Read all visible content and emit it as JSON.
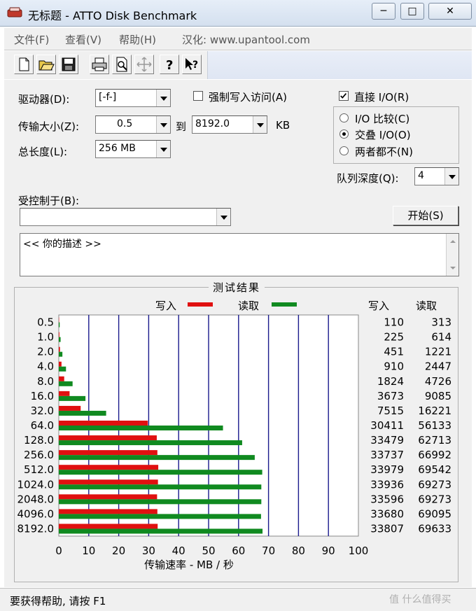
{
  "window": {
    "title": "无标题 - ATTO Disk Benchmark",
    "minimize": "─",
    "maximize": "□",
    "close": "✕"
  },
  "menu": [
    "文件(F)",
    "查看(V)",
    "帮助(H)",
    "汉化: www.upantool.com"
  ],
  "toolbar": [
    "new-icon",
    "open-icon",
    "save-icon",
    "print-icon",
    "print-preview-icon",
    "move-icon",
    "help-icon",
    "context-help-icon"
  ],
  "form": {
    "drive_label": "驱动器(D):",
    "drive_value": "[-f-]",
    "force_write_label": "强制写入访问(A)",
    "force_write_checked": false,
    "direct_io_label": "直接 I/O(R)",
    "direct_io_checked": true,
    "transfer_label": "传输大小(Z):",
    "transfer_from": "0.5",
    "to_label": "到",
    "transfer_to": "8192.0",
    "kb_label": "KB",
    "total_label": "总长度(L):",
    "total_value": "256 MB",
    "radio_options": [
      "I/O 比较(C)",
      "交叠 I/O(O)",
      "两者都不(N)"
    ],
    "radio_selected": 1,
    "queue_label": "队列深度(Q):",
    "queue_value": "4",
    "controlled_label": "受控制于(B):",
    "controlled_value": "",
    "start_button": "开始(S)",
    "description": "<< 你的描述 >>"
  },
  "results": {
    "title": "测试结果",
    "write_legend": "写入",
    "read_legend": "读取",
    "write_header": "写入",
    "read_header": "读取",
    "write_color": "#e01010",
    "read_color": "#108a20"
  },
  "chart_data": {
    "type": "bar",
    "orientation": "horizontal",
    "title": "测试结果",
    "xlabel": "传输速率 - MB / 秒",
    "xlim": [
      0,
      100
    ],
    "xticks": [
      "0",
      "10",
      "20",
      "30",
      "40",
      "50",
      "60",
      "70",
      "80",
      "90",
      "100"
    ],
    "grid": true,
    "legend_placement": "top",
    "categories": [
      "0.5",
      "1.0",
      "2.0",
      "4.0",
      "8.0",
      "16.0",
      "32.0",
      "64.0",
      "128.0",
      "256.0",
      "512.0",
      "1024.0",
      "2048.0",
      "4096.0",
      "8192.0"
    ],
    "series": [
      {
        "name": "写入",
        "color": "#e01010",
        "values": [
          0.1,
          0.2,
          0.4,
          0.9,
          1.8,
          3.6,
          7.3,
          29.7,
          32.7,
          32.9,
          33.2,
          33.1,
          32.8,
          32.9,
          33.0
        ],
        "labels": [
          "110",
          "225",
          "451",
          "910",
          "1824",
          "3673",
          "7515",
          "30411",
          "33479",
          "33737",
          "33979",
          "33936",
          "33596",
          "33680",
          "33807"
        ]
      },
      {
        "name": "读取",
        "color": "#108a20",
        "values": [
          0.3,
          0.6,
          1.2,
          2.4,
          4.6,
          8.9,
          15.8,
          54.8,
          61.2,
          65.4,
          67.9,
          67.6,
          67.6,
          67.5,
          68.0
        ],
        "labels": [
          "313",
          "614",
          "1221",
          "2447",
          "4726",
          "9085",
          "16221",
          "56133",
          "62713",
          "66992",
          "69542",
          "69273",
          "69273",
          "69095",
          "69633"
        ]
      }
    ]
  },
  "status": {
    "text": "要获得帮助, 请按 F1",
    "watermark": "值 什么值得买"
  }
}
